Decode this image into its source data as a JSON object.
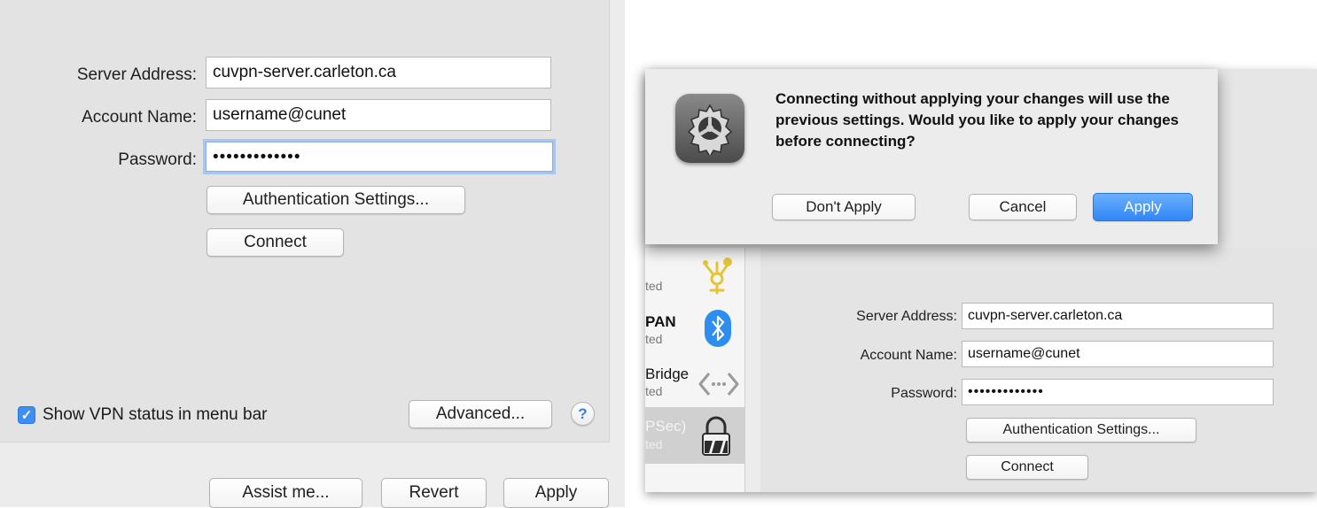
{
  "left": {
    "server_address_label": "Server Address:",
    "server_address_value": "cuvpn-server.carleton.ca",
    "account_name_label": "Account Name:",
    "account_name_value": "username@cunet",
    "password_label": "Password:",
    "password_value": "•••••••••••••",
    "auth_settings_button": "Authentication Settings...",
    "connect_button": "Connect",
    "show_vpn_status_label": "Show VPN status in menu bar",
    "show_vpn_status_checked": true,
    "advanced_button": "Advanced...",
    "help_button": "?",
    "assist_button": "Assist me...",
    "revert_button": "Revert",
    "apply_button": "Apply"
  },
  "alert": {
    "message": "Connecting without applying your changes will use the previous settings. Would you like to apply your changes before connecting?",
    "dont_apply_button": "Don't Apply",
    "cancel_button": "Cancel",
    "apply_button": "Apply",
    "icon": "system-preferences-gear-icon"
  },
  "sidebar": {
    "items": [
      {
        "name": "",
        "status": "ted",
        "icon": "firewire-icon"
      },
      {
        "name": "PAN",
        "status": "ted",
        "icon": "bluetooth-icon"
      },
      {
        "name": "Bridge",
        "status": "ted",
        "icon": "bridge-icon"
      },
      {
        "name": "PSec)",
        "status": "ted",
        "icon": "vpn-lock-icon",
        "selected": true
      }
    ]
  },
  "right": {
    "server_address_label": "Server Address:",
    "server_address_value": "cuvpn-server.carleton.ca",
    "account_name_label": "Account Name:",
    "account_name_value": "username@cunet",
    "password_label": "Password:",
    "password_value": "•••••••••••••",
    "auth_settings_button": "Authentication Settings...",
    "connect_button": "Connect"
  },
  "colors": {
    "accent": "#2f86f5",
    "panel_bg": "#e3e3e3",
    "focus_ring": "#a8c7ef"
  }
}
